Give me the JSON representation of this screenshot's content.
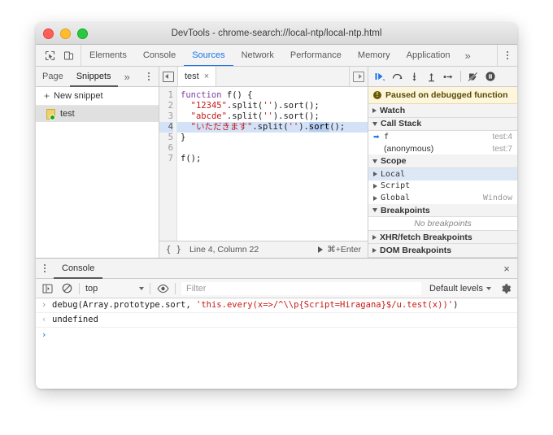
{
  "window": {
    "title": "DevTools - chrome-search://local-ntp/local-ntp.html",
    "traffic_lights": [
      "close-red",
      "minimize-yellow",
      "zoom-green"
    ]
  },
  "devtools": {
    "inspect_icon": "inspect-element-icon",
    "device_icon": "device-toolbar-icon",
    "tabs": [
      {
        "label": "Elements",
        "active": false
      },
      {
        "label": "Console",
        "active": false
      },
      {
        "label": "Sources",
        "active": true
      },
      {
        "label": "Network",
        "active": false
      },
      {
        "label": "Performance",
        "active": false
      },
      {
        "label": "Memory",
        "active": false
      },
      {
        "label": "Application",
        "active": false
      }
    ],
    "more_tabs": "»",
    "main_menu_icon": "kebab-menu-icon",
    "accent_color": "#1a73e8"
  },
  "navigator": {
    "tabs": [
      {
        "label": "Page",
        "active": false
      },
      {
        "label": "Snippets",
        "active": true
      }
    ],
    "more": "»",
    "menu_icon": "kebab-menu-icon",
    "new_snippet_label": "New snippet",
    "new_snippet_plus": "+",
    "snippets": [
      {
        "name": "test",
        "selected": true
      }
    ]
  },
  "editor": {
    "panel_toggle_icon": "show-navigator-icon",
    "right_toggle_icon": "show-debugger-icon",
    "tab": {
      "label": "test",
      "close": "×"
    },
    "line_numbers": [
      "1",
      "2",
      "3",
      "4",
      "5",
      "6",
      "7"
    ],
    "current_line": 4,
    "code_lines": [
      {
        "n": 1,
        "tokens": [
          {
            "t": "function",
            "c": "kw"
          },
          {
            "t": " f() {",
            "c": "plain"
          }
        ]
      },
      {
        "n": 2,
        "tokens": [
          {
            "t": "  ",
            "c": "plain"
          },
          {
            "t": "\"12345\"",
            "c": "str"
          },
          {
            "t": ".split(",
            "c": "plain"
          },
          {
            "t": "''",
            "c": "str"
          },
          {
            "t": ").sort();",
            "c": "plain"
          }
        ]
      },
      {
        "n": 3,
        "tokens": [
          {
            "t": "  ",
            "c": "plain"
          },
          {
            "t": "\"abcde\"",
            "c": "str"
          },
          {
            "t": ".split(",
            "c": "plain"
          },
          {
            "t": "''",
            "c": "str"
          },
          {
            "t": ").sort();",
            "c": "plain"
          }
        ]
      },
      {
        "n": 4,
        "tokens": [
          {
            "t": "  ",
            "c": "plain"
          },
          {
            "t": "\"いただきます\"",
            "c": "str"
          },
          {
            "t": ".split(",
            "c": "plain"
          },
          {
            "t": "''",
            "c": "str"
          },
          {
            "t": ").",
            "c": "plain"
          },
          {
            "t": "sort",
            "c": "sel"
          },
          {
            "t": "();",
            "c": "plain"
          }
        ]
      },
      {
        "n": 5,
        "tokens": [
          {
            "t": "}",
            "c": "plain"
          }
        ]
      },
      {
        "n": 6,
        "tokens": [
          {
            "t": "",
            "c": "plain"
          }
        ]
      },
      {
        "n": 7,
        "tokens": [
          {
            "t": "f();",
            "c": "plain"
          }
        ]
      }
    ],
    "status": {
      "format_icon": "pretty-print-braces-icon",
      "position": "Line 4, Column 22",
      "run_icon": "run-snippet-icon",
      "run_shortcut": "⌘+Enter"
    }
  },
  "debugger": {
    "toolbar": [
      {
        "name": "resume-script-execution",
        "glyph": "resume"
      },
      {
        "name": "step-over-next-function-call",
        "glyph": "step-over"
      },
      {
        "name": "step-into-next-function-call",
        "glyph": "step-into"
      },
      {
        "name": "step-out-of-current-function",
        "glyph": "step-out"
      },
      {
        "name": "step",
        "glyph": "step"
      },
      {
        "name": "deactivate-breakpoints",
        "glyph": "deactivate-breakpoints"
      },
      {
        "name": "pause-on-exceptions",
        "glyph": "pause-on-exceptions"
      }
    ],
    "paused_banner": {
      "icon": "!",
      "text": "Paused on debugged function"
    },
    "sections": [
      {
        "title": "Watch",
        "expanded": false
      },
      {
        "title": "Call Stack",
        "expanded": true
      },
      {
        "title": "Scope",
        "expanded": true
      },
      {
        "title": "Breakpoints",
        "expanded": true
      },
      {
        "title": "XHR/fetch Breakpoints",
        "expanded": false
      },
      {
        "title": "DOM Breakpoints",
        "expanded": false
      }
    ],
    "call_stack": [
      {
        "name": "f",
        "location": "test:4",
        "current": true
      },
      {
        "name": "(anonymous)",
        "location": "test:7",
        "current": false
      }
    ],
    "scope": [
      {
        "name": "Local",
        "value": "",
        "selected": true
      },
      {
        "name": "Script",
        "value": "",
        "selected": false
      },
      {
        "name": "Global",
        "value": "Window",
        "selected": false
      }
    ],
    "breakpoints_empty_text": "No breakpoints"
  },
  "drawer": {
    "menu_icon": "kebab-menu-icon",
    "tab_label": "Console",
    "close_label": "×",
    "toolbar": {
      "sidebar_icon": "console-sidebar-icon",
      "clear_icon": "clear-console-icon",
      "context": "top",
      "eye_icon": "live-expression-eye-icon",
      "filter_placeholder": "Filter",
      "levels_label": "Default levels",
      "settings_icon": "gear-icon"
    },
    "messages": [
      {
        "kind": "input",
        "chevron": "›",
        "parts": [
          {
            "t": "debug(Array.prototype.sort, ",
            "c": "plain"
          },
          {
            "t": "'this.every(x=>/^\\\\p{Script=Hiragana}$/u.test(x))'",
            "c": "str"
          },
          {
            "t": ")",
            "c": "plain"
          }
        ]
      },
      {
        "kind": "output",
        "chevron": "‹",
        "parts": [
          {
            "t": "undefined",
            "c": "plain"
          }
        ]
      }
    ],
    "prompt_chevron": "›"
  }
}
